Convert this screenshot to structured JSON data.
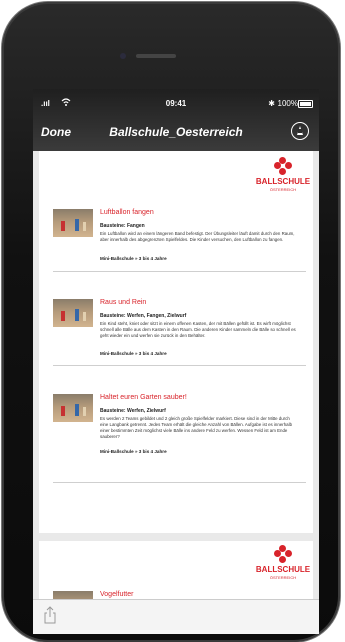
{
  "status_bar": {
    "time": "09:41",
    "battery": "100%"
  },
  "nav": {
    "done_label": "Done",
    "title": "Ballschule_Oesterreich"
  },
  "logo": {
    "name": "BALLSCHULE",
    "sub": "ÖSTERREICH"
  },
  "entries": [
    {
      "title": "Luftballon fangen",
      "building_blocks": "Bausteine: Fangen",
      "description": "Ein Luftballon wird an einem längeren Band befestigt. Der Übungsleiter läuft damit durch den Raum, aber innerhalb des abgegrenzten Spielfeldes. Die Kinder versuchen, den Luftballon zu fangen.",
      "age": "Mini-Ballschule » 3 bis 4 Jahre"
    },
    {
      "title": "Raus und Rein",
      "building_blocks": "Bausteine: Werfen, Fangen, Zielwurf",
      "description": "Ein Kind steht, kniet oder sitzt in einem offenen Kasten, der mit Bällen gefüllt ist. Es wirft möglichst schnell alle Bälle aus dem Kasten in den Raum. Die anderen Kinder sammeln die Bälle so schnell es geht wieder ein und werfen sie zurück in den Behälter.",
      "age": "Mini-Ballschule » 3 bis 4 Jahre"
    },
    {
      "title": "Haltet euren Garten sauber!",
      "building_blocks": "Bausteine: Werfen, Zielwurf",
      "description": "Es werden 2 Teams gebildet und 2 gleich große Spielfelder markiert. Diese sind in der Mitte durch eine Langbank getrennt. Jedes Team erhält die gleiche Anzahl von Bällen. Aufgabe ist es innerhalb einer bestimmten Zeit möglichst viele Bälle ins andere Feld zu werfen. Wessen Feld ist am Ende sauberer?",
      "age": "Mini-Ballschule » 3 bis 4 Jahre"
    },
    {
      "title": "Vogelfutter"
    }
  ]
}
